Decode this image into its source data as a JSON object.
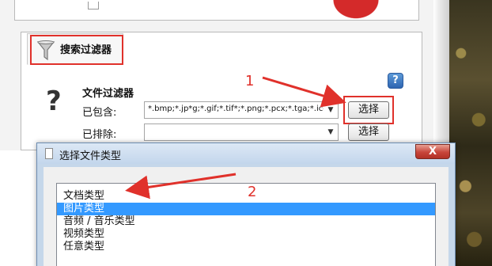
{
  "filter_tab": {
    "label": "搜索过滤器"
  },
  "file_filter": {
    "title": "文件过滤器",
    "include_label": "已包含:",
    "include_value": "*.bmp;*.jp*g;*.gif;*.tif*;*.png;*.pcx;*.tga;*.ico",
    "exclude_label": "已排除:",
    "exclude_value": "",
    "include_button": "选择",
    "exclude_button": "选择"
  },
  "help_icon_glyph": "?",
  "dialog": {
    "title": "选择文件类型",
    "close_glyph": "X",
    "items": [
      {
        "label": "文档类型",
        "selected": false
      },
      {
        "label": "图片类型",
        "selected": true
      },
      {
        "label": "音频 / 音乐类型",
        "selected": false
      },
      {
        "label": "视频类型",
        "selected": false
      },
      {
        "label": "任意类型",
        "selected": false
      }
    ]
  },
  "annotations": {
    "step1": "1",
    "step2": "2",
    "color": "#e0312b"
  },
  "colors": {
    "selection": "#3399ff",
    "highlight": "#e0312b",
    "dialog_frame": "#c5d7ea"
  }
}
